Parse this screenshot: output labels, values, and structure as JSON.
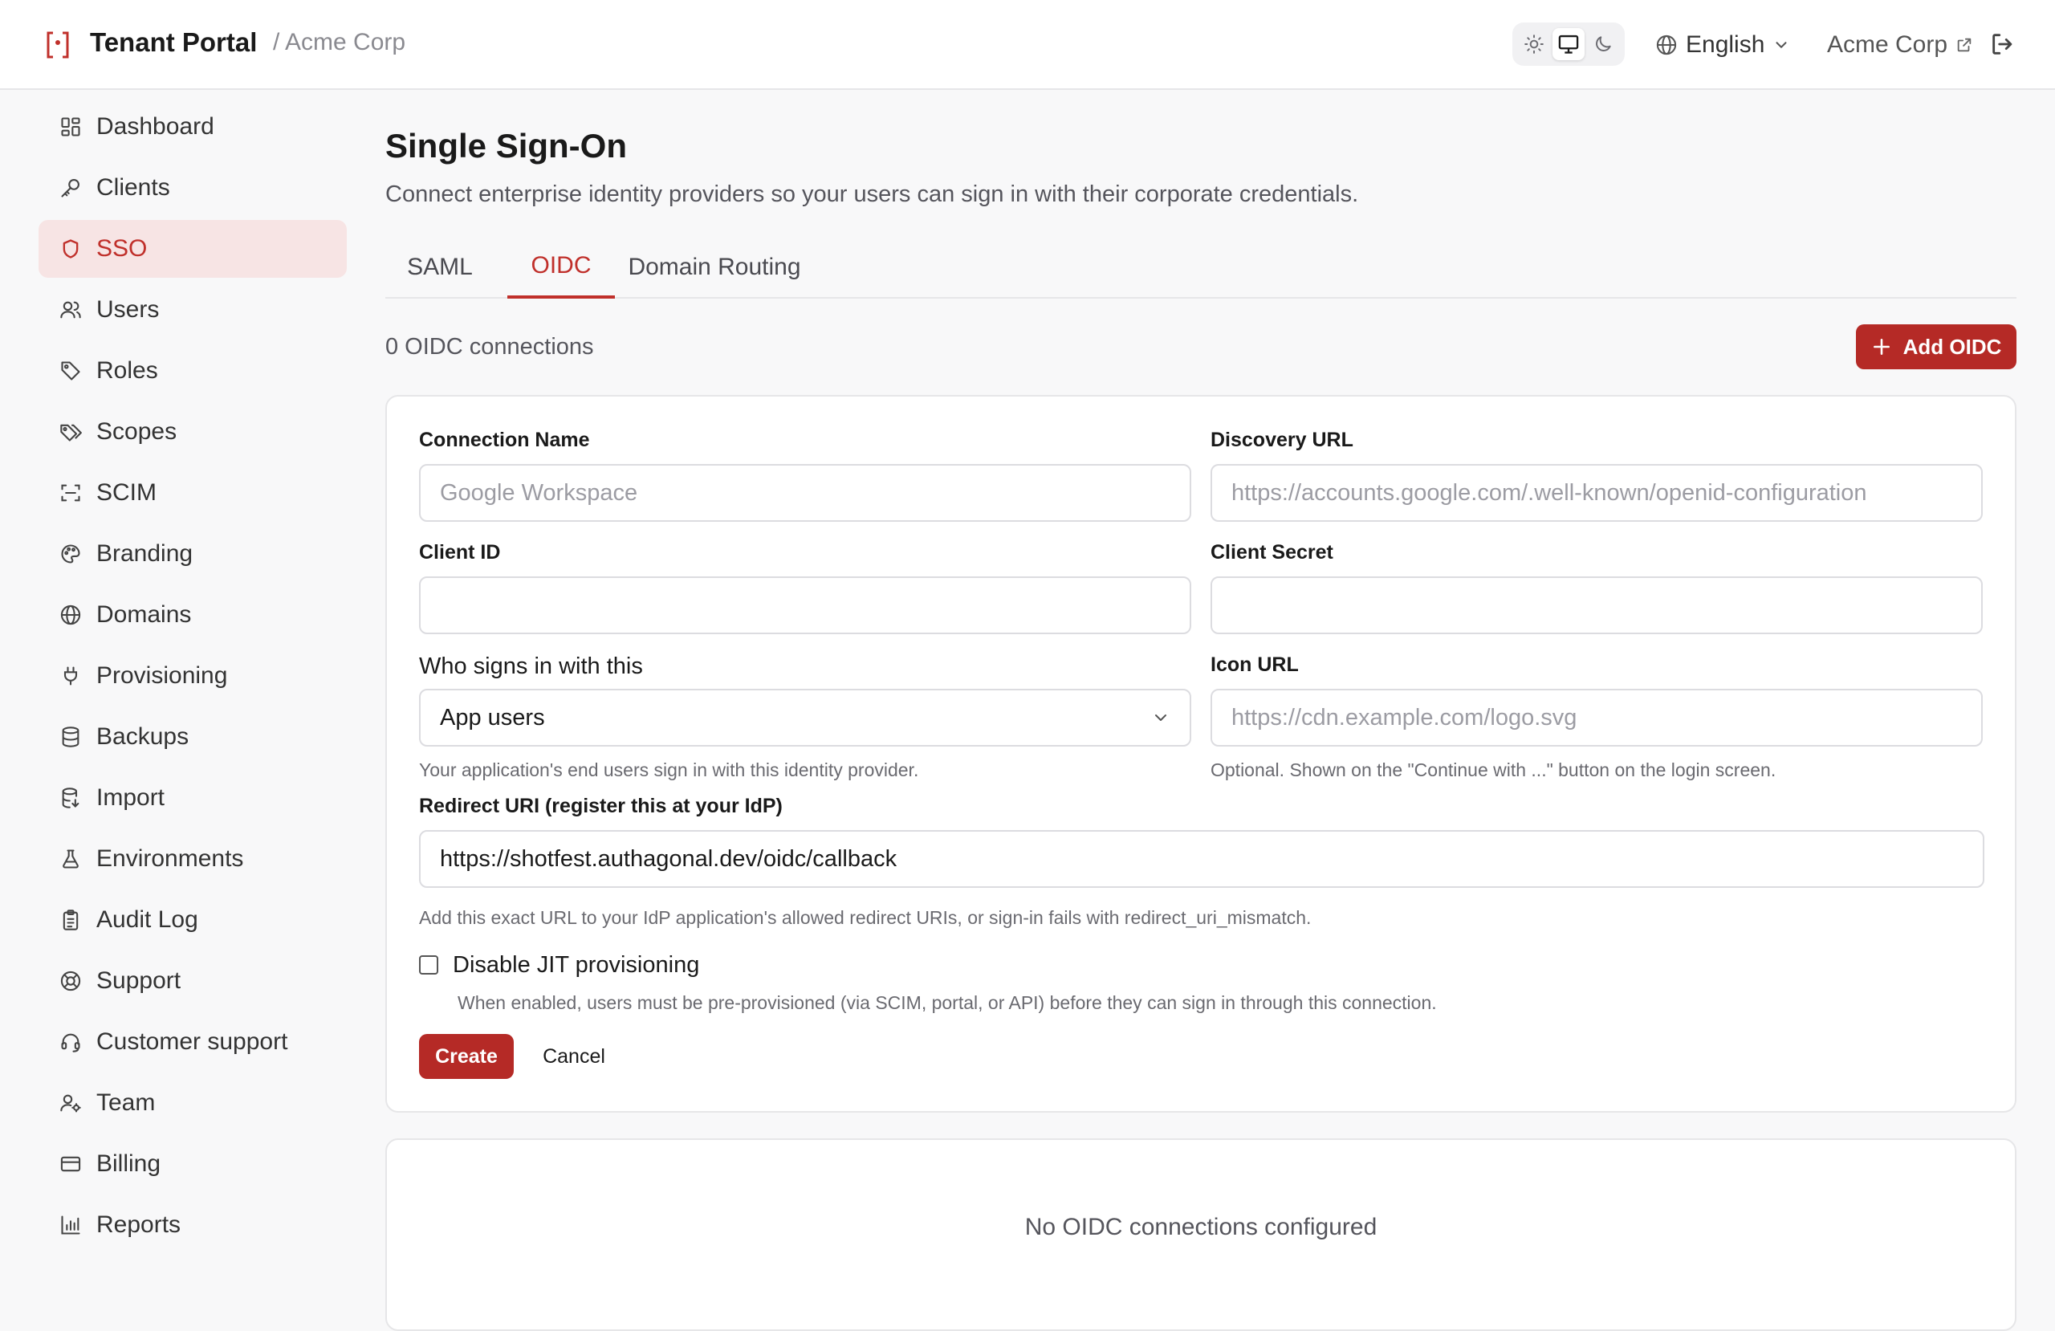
{
  "header": {
    "brand": "Tenant Portal",
    "breadcrumb": "/ Acme Corp",
    "language": "English",
    "org_link": "Acme Corp"
  },
  "sidebar": {
    "items": [
      {
        "label": "Dashboard",
        "icon": "dashboard-icon"
      },
      {
        "label": "Clients",
        "icon": "key-icon"
      },
      {
        "label": "SSO",
        "icon": "shield-icon",
        "active": true
      },
      {
        "label": "Users",
        "icon": "users-icon"
      },
      {
        "label": "Roles",
        "icon": "tag-icon"
      },
      {
        "label": "Scopes",
        "icon": "tags-icon"
      },
      {
        "label": "SCIM",
        "icon": "scan-icon"
      },
      {
        "label": "Branding",
        "icon": "palette-icon"
      },
      {
        "label": "Domains",
        "icon": "globe-icon"
      },
      {
        "label": "Provisioning",
        "icon": "plug-icon"
      },
      {
        "label": "Backups",
        "icon": "database-icon"
      },
      {
        "label": "Import",
        "icon": "database-import-icon"
      },
      {
        "label": "Environments",
        "icon": "flask-icon"
      },
      {
        "label": "Audit Log",
        "icon": "clipboard-icon"
      },
      {
        "label": "Support",
        "icon": "lifebuoy-icon"
      },
      {
        "label": "Customer support",
        "icon": "headset-icon"
      },
      {
        "label": "Team",
        "icon": "user-cog-icon"
      },
      {
        "label": "Billing",
        "icon": "credit-card-icon"
      },
      {
        "label": "Reports",
        "icon": "bar-chart-icon"
      }
    ]
  },
  "main": {
    "title": "Single Sign-On",
    "subtitle": "Connect enterprise identity providers so your users can sign in with their corporate credentials.",
    "tabs": [
      {
        "label": "SAML"
      },
      {
        "label": "OIDC",
        "active": true
      },
      {
        "label": "Domain Routing"
      }
    ],
    "count_text": "0 OIDC connections",
    "add_button": "Add OIDC",
    "form": {
      "connection_name": {
        "label": "Connection Name",
        "placeholder": "Google Workspace",
        "value": ""
      },
      "discovery_url": {
        "label": "Discovery URL",
        "placeholder": "https://accounts.google.com/.well-known/openid-configuration",
        "value": ""
      },
      "client_id": {
        "label": "Client ID",
        "value": ""
      },
      "client_secret": {
        "label": "Client Secret",
        "value": ""
      },
      "who_signs_in": {
        "label": "Who signs in with this",
        "value": "App users",
        "hint": "Your application's end users sign in with this identity provider."
      },
      "icon_url": {
        "label": "Icon URL",
        "placeholder": "https://cdn.example.com/logo.svg",
        "value": "",
        "hint": "Optional. Shown on the \"Continue with ...\" button on the login screen."
      },
      "redirect_uri": {
        "label": "Redirect URI (register this at your IdP)",
        "value": "https://shotfest.authagonal.dev/oidc/callback",
        "hint": "Add this exact URL to your IdP application's allowed redirect URIs, or sign-in fails with redirect_uri_mismatch."
      },
      "disable_jit": {
        "label": "Disable JIT provisioning",
        "checked": false,
        "hint": "When enabled, users must be pre-provisioned (via SCIM, portal, or API) before they can sign in through this connection."
      },
      "create_button": "Create",
      "cancel_button": "Cancel"
    },
    "empty_state": "No OIDC connections configured"
  },
  "colors": {
    "accent": "#b52a26",
    "active_nav_bg": "#f7e4e4",
    "active_text": "#c0302b"
  }
}
